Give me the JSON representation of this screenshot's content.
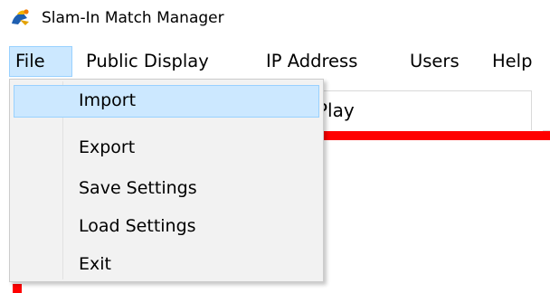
{
  "window": {
    "title": "Slam-In Match Manager",
    "icon": "app-logo-icon"
  },
  "menubar": {
    "items": [
      {
        "label": "File",
        "active": true
      },
      {
        "label": "Public Display"
      },
      {
        "label": "IP Address"
      },
      {
        "label": "Users"
      },
      {
        "label": "Help"
      }
    ]
  },
  "file_menu": {
    "items": [
      {
        "label": "Import",
        "highlighted": true
      },
      {
        "label": "Export"
      },
      {
        "label": "Save Settings"
      },
      {
        "label": "Load Settings"
      },
      {
        "label": "Exit"
      }
    ]
  },
  "background": {
    "tab_label": "Play"
  },
  "colors": {
    "highlight_fill": "#cce8ff",
    "highlight_border": "#99d1ff",
    "menu_background": "#f2f2f2",
    "accent_red": "#ff0000"
  }
}
